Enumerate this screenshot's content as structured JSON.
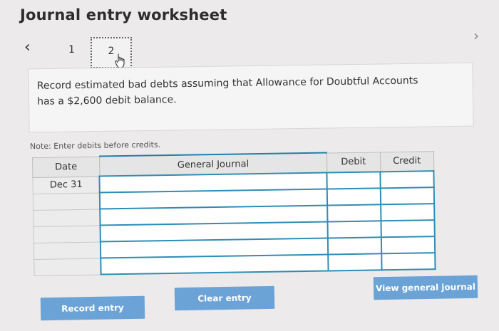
{
  "header": {
    "title": "Journal entry worksheet"
  },
  "navigation": {
    "prev_icon": "chevron-left-icon",
    "next_icon": "chevron-right-icon",
    "steps": [
      {
        "label": "1"
      },
      {
        "label": "2"
      }
    ],
    "active_step": "2"
  },
  "instruction": {
    "text": "Record estimated bad debts assuming that Allowance for Doubtful Accounts has a $2,600 debit balance."
  },
  "note": {
    "text": "Note: Enter debits before credits."
  },
  "journal": {
    "columns": {
      "date": "Date",
      "general_journal": "General Journal",
      "debit": "Debit",
      "credit": "Credit"
    },
    "rows": [
      {
        "date": "Dec 31",
        "account": "",
        "debit": "",
        "credit": ""
      },
      {
        "date": "",
        "account": "",
        "debit": "",
        "credit": ""
      },
      {
        "date": "",
        "account": "",
        "debit": "",
        "credit": ""
      },
      {
        "date": "",
        "account": "",
        "debit": "",
        "credit": ""
      },
      {
        "date": "",
        "account": "",
        "debit": "",
        "credit": ""
      },
      {
        "date": "",
        "account": "",
        "debit": "",
        "credit": ""
      }
    ]
  },
  "buttons": {
    "record": "Record entry",
    "clear": "Clear entry",
    "view": "View general journal"
  },
  "colors": {
    "button": "#6ba3d6",
    "input_border": "#2f8db5"
  }
}
